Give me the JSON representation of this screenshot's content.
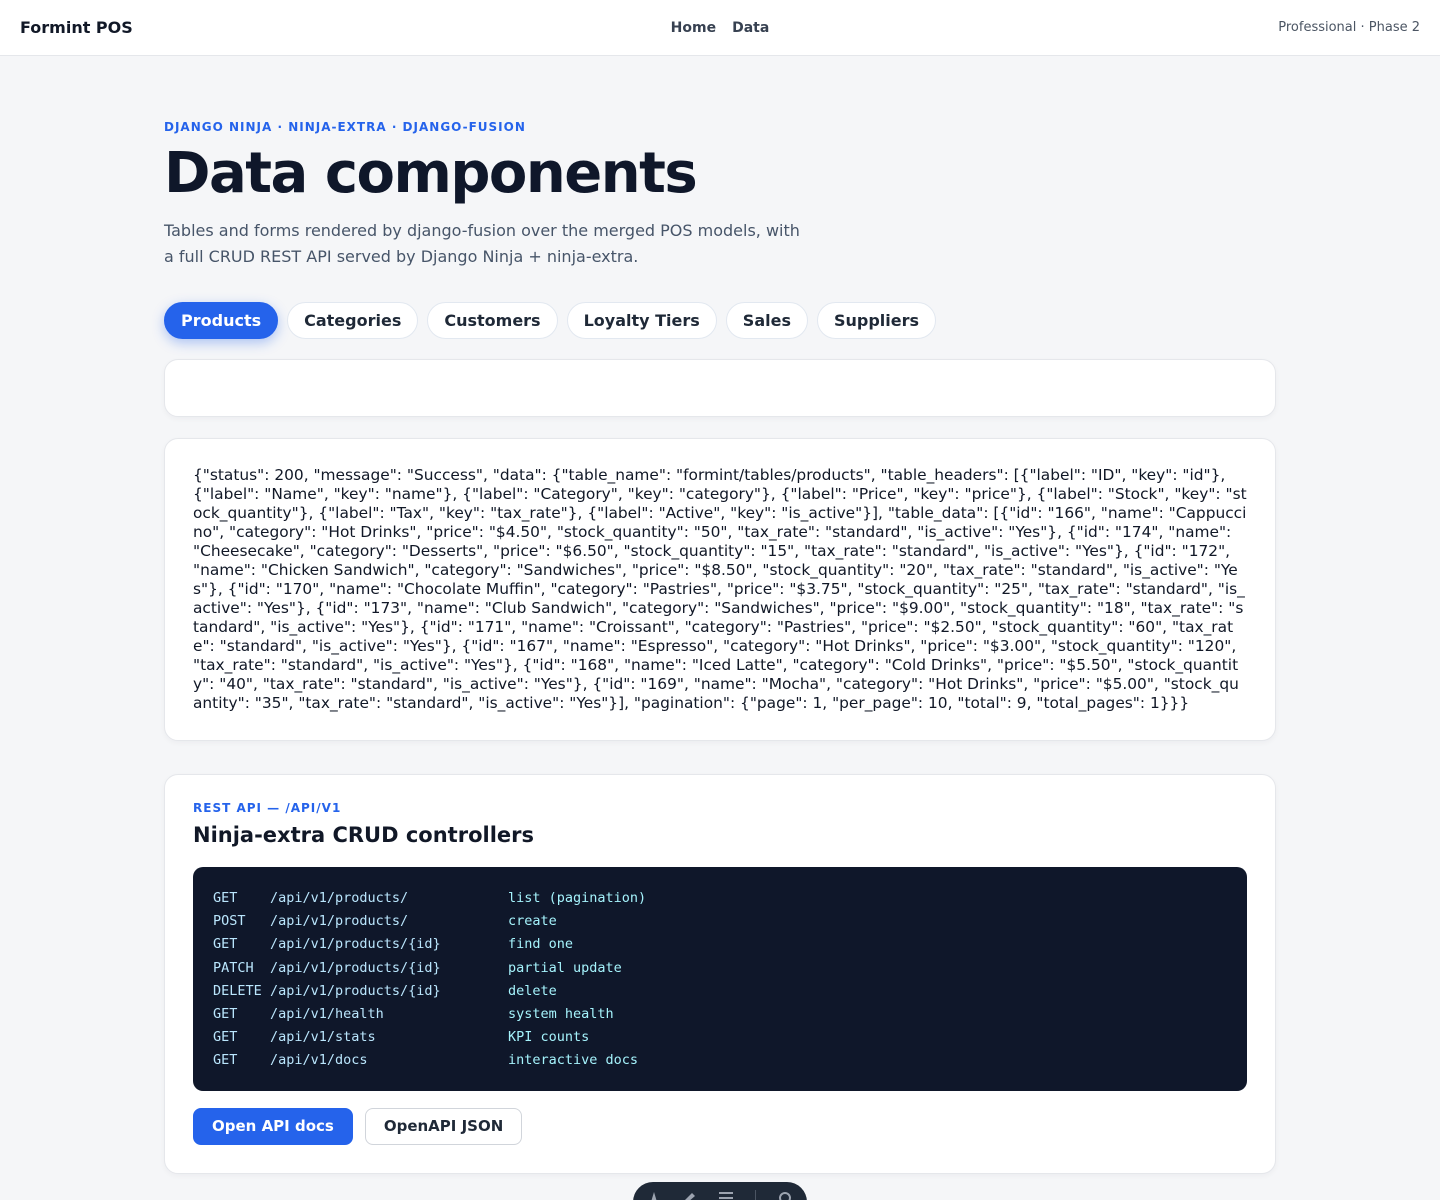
{
  "header": {
    "brand": "Formint POS",
    "nav": [
      {
        "label": "Home"
      },
      {
        "label": "Data"
      }
    ],
    "tier": "Professional · Phase 2"
  },
  "hero": {
    "eyebrow": "DJANGO NINJA · NINJA-EXTRA · DJANGO-FUSION",
    "title": "Data components",
    "subtitle": "Tables and forms rendered by django-fusion over the merged POS models, with a full CRUD REST API served by Django Ninja + ninja-extra."
  },
  "tabs": [
    {
      "label": "Products",
      "active": true
    },
    {
      "label": "Categories",
      "active": false
    },
    {
      "label": "Customers",
      "active": false
    },
    {
      "label": "Loyalty Tiers",
      "active": false
    },
    {
      "label": "Sales",
      "active": false
    },
    {
      "label": "Suppliers",
      "active": false
    }
  ],
  "json_output": "{\"status\": 200, \"message\": \"Success\", \"data\": {\"table_name\": \"formint/tables/products\", \"table_headers\": [{\"label\": \"ID\", \"key\": \"id\"}, {\"label\": \"Name\", \"key\": \"name\"}, {\"label\": \"Category\", \"key\": \"category\"}, {\"label\": \"Price\", \"key\": \"price\"}, {\"label\": \"Stock\", \"key\": \"stock_quantity\"}, {\"label\": \"Tax\", \"key\": \"tax_rate\"}, {\"label\": \"Active\", \"key\": \"is_active\"}], \"table_data\": [{\"id\": \"166\", \"name\": \"Cappuccino\", \"category\": \"Hot Drinks\", \"price\": \"$4.50\", \"stock_quantity\": \"50\", \"tax_rate\": \"standard\", \"is_active\": \"Yes\"}, {\"id\": \"174\", \"name\": \"Cheesecake\", \"category\": \"Desserts\", \"price\": \"$6.50\", \"stock_quantity\": \"15\", \"tax_rate\": \"standard\", \"is_active\": \"Yes\"}, {\"id\": \"172\", \"name\": \"Chicken Sandwich\", \"category\": \"Sandwiches\", \"price\": \"$8.50\", \"stock_quantity\": \"20\", \"tax_rate\": \"standard\", \"is_active\": \"Yes\"}, {\"id\": \"170\", \"name\": \"Chocolate Muffin\", \"category\": \"Pastries\", \"price\": \"$3.75\", \"stock_quantity\": \"25\", \"tax_rate\": \"standard\", \"is_active\": \"Yes\"}, {\"id\": \"173\", \"name\": \"Club Sandwich\", \"category\": \"Sandwiches\", \"price\": \"$9.00\", \"stock_quantity\": \"18\", \"tax_rate\": \"standard\", \"is_active\": \"Yes\"}, {\"id\": \"171\", \"name\": \"Croissant\", \"category\": \"Pastries\", \"price\": \"$2.50\", \"stock_quantity\": \"60\", \"tax_rate\": \"standard\", \"is_active\": \"Yes\"}, {\"id\": \"167\", \"name\": \"Espresso\", \"category\": \"Hot Drinks\", \"price\": \"$3.00\", \"stock_quantity\": \"120\", \"tax_rate\": \"standard\", \"is_active\": \"Yes\"}, {\"id\": \"168\", \"name\": \"Iced Latte\", \"category\": \"Cold Drinks\", \"price\": \"$5.50\", \"stock_quantity\": \"40\", \"tax_rate\": \"standard\", \"is_active\": \"Yes\"}, {\"id\": \"169\", \"name\": \"Mocha\", \"category\": \"Hot Drinks\", \"price\": \"$5.00\", \"stock_quantity\": \"35\", \"tax_rate\": \"standard\", \"is_active\": \"Yes\"}], \"pagination\": {\"page\": 1, \"per_page\": 10, \"total\": 9, \"total_pages\": 1}}}",
  "api": {
    "eyebrow": "REST API — /API/V1",
    "title": "Ninja-extra CRUD controllers",
    "endpoints": [
      {
        "method": "GET",
        "path": "/api/v1/products/",
        "desc": "list (pagination)"
      },
      {
        "method": "POST",
        "path": "/api/v1/products/",
        "desc": "create"
      },
      {
        "method": "GET",
        "path": "/api/v1/products/{id}",
        "desc": "find one"
      },
      {
        "method": "PATCH",
        "path": "/api/v1/products/{id}",
        "desc": "partial update"
      },
      {
        "method": "DELETE",
        "path": "/api/v1/products/{id}",
        "desc": "delete"
      },
      {
        "method": "GET",
        "path": "/api/v1/health",
        "desc": "system health"
      },
      {
        "method": "GET",
        "path": "/api/v1/stats",
        "desc": "KPI counts"
      },
      {
        "method": "GET",
        "path": "/api/v1/docs",
        "desc": "interactive docs"
      }
    ],
    "primary_button": "Open API docs",
    "secondary_button": "OpenAPI JSON"
  },
  "floating_toolbar": {
    "icons": [
      "pen-icon",
      "brush-icon",
      "menu-icon",
      "gear-icon"
    ]
  },
  "colors": {
    "accent": "#2563eb",
    "code_bg": "#0f172a",
    "page_bg": "#f5f6f8"
  }
}
